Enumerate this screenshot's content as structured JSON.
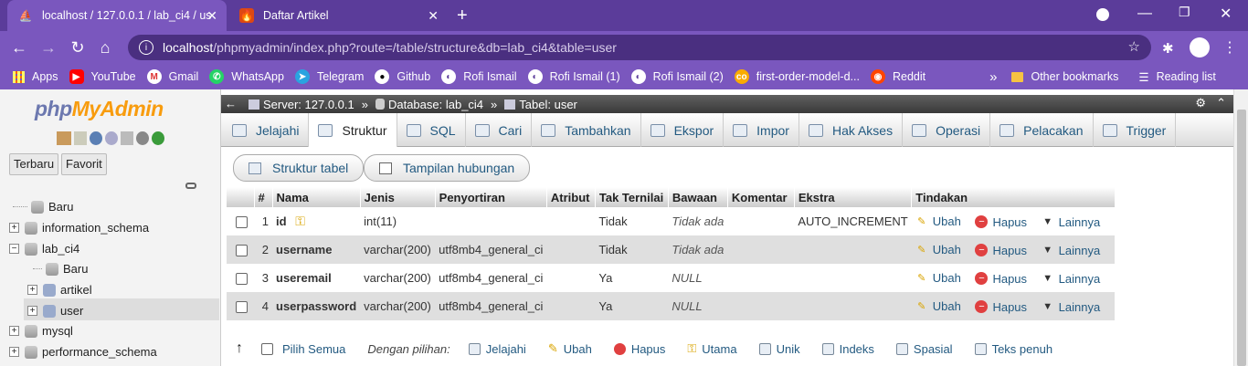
{
  "browser": {
    "tabs": [
      {
        "title": "localhost / 127.0.0.1 / lab_ci4 / us",
        "icon": "phpmyadmin-icon",
        "active": true
      },
      {
        "title": "Daftar Artikel",
        "icon": "codeigniter-icon",
        "active": false
      }
    ],
    "url_host": "localhost",
    "url_path": "/phpmyadmin/index.php?route=/table/structure&db=lab_ci4&table=user",
    "bookmarks": [
      "Apps",
      "YouTube",
      "Gmail",
      "WhatsApp",
      "Telegram",
      "Github",
      "Rofi Ismail",
      "Rofi Ismail (1)",
      "Rofi Ismail (2)",
      "first-order-model-d...",
      "Reddit"
    ],
    "more_bookmarks": "»",
    "other_bookmarks": "Other bookmarks",
    "reading_list": "Reading list"
  },
  "sidebar": {
    "logo_php": "php",
    "logo_myadmin": "MyAdmin",
    "btn_recent": "Terbaru",
    "btn_favorite": "Favorit",
    "tree": [
      {
        "label": "Baru",
        "level": 0
      },
      {
        "label": "information_schema",
        "level": 0
      },
      {
        "label": "lab_ci4",
        "level": 0
      },
      {
        "label": "Baru",
        "level": 1
      },
      {
        "label": "artikel",
        "level": 1
      },
      {
        "label": "user",
        "level": 1
      },
      {
        "label": "mysql",
        "level": 0
      },
      {
        "label": "performance_schema",
        "level": 0
      }
    ]
  },
  "breadcrumb": {
    "server": "Server: 127.0.0.1",
    "database": "Database: lab_ci4",
    "table": "Tabel: user",
    "sep": "»"
  },
  "tabs": [
    "Jelajahi",
    "Struktur",
    "SQL",
    "Cari",
    "Tambahkan",
    "Ekspor",
    "Impor",
    "Hak Akses",
    "Operasi",
    "Pelacakan",
    "Trigger"
  ],
  "active_tab": "Struktur",
  "subbuttons": {
    "structure": "Struktur tabel",
    "relation": "Tampilan hubungan"
  },
  "table": {
    "headers": [
      "#",
      "Nama",
      "Jenis",
      "Penyortiran",
      "Atribut",
      "Tak Ternilai",
      "Bawaan",
      "Komentar",
      "Ekstra",
      "Tindakan"
    ],
    "rows": [
      {
        "num": "1",
        "name": "id",
        "type": "int(11)",
        "collation": "",
        "attr": "",
        "null": "Tidak",
        "default": "Tidak ada",
        "comment": "",
        "extra": "AUTO_INCREMENT"
      },
      {
        "num": "2",
        "name": "username",
        "type": "varchar(200)",
        "collation": "utf8mb4_general_ci",
        "attr": "",
        "null": "Tidak",
        "default": "Tidak ada",
        "comment": "",
        "extra": ""
      },
      {
        "num": "3",
        "name": "useremail",
        "type": "varchar(200)",
        "collation": "utf8mb4_general_ci",
        "attr": "",
        "null": "Ya",
        "default": "NULL",
        "comment": "",
        "extra": ""
      },
      {
        "num": "4",
        "name": "userpassword",
        "type": "varchar(200)",
        "collation": "utf8mb4_general_ci",
        "attr": "",
        "null": "Ya",
        "default": "NULL",
        "comment": "",
        "extra": ""
      }
    ],
    "actions": {
      "edit": "Ubah",
      "drop": "Hapus",
      "more": "Lainnya"
    }
  },
  "bulk": {
    "check_all": "Pilih Semua",
    "with_selected": "Dengan pilihan:",
    "actions": [
      "Jelajahi",
      "Ubah",
      "Hapus",
      "Utama",
      "Unik",
      "Indeks",
      "Spasial",
      "Teks penuh"
    ]
  }
}
